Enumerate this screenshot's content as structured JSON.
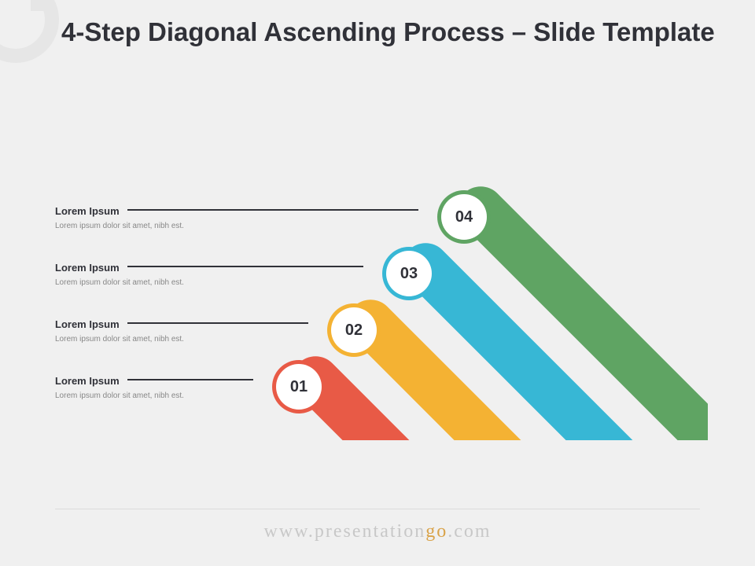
{
  "title": "4-Step Diagonal Ascending Process – Slide Template",
  "steps": [
    {
      "num": "01",
      "title": "Lorem Ipsum",
      "sub": "Lorem ipsum dolor sit amet, nibh est.",
      "color": "#e85a46"
    },
    {
      "num": "02",
      "title": "Lorem Ipsum",
      "sub": "Lorem ipsum dolor sit amet, nibh est.",
      "color": "#f4b233"
    },
    {
      "num": "03",
      "title": "Lorem Ipsum",
      "sub": "Lorem ipsum dolor sit amet, nibh est.",
      "color": "#37b7d5"
    },
    {
      "num": "04",
      "title": "Lorem Ipsum",
      "sub": "Lorem ipsum dolor sit amet, nibh est.",
      "color": "#5fa463"
    }
  ],
  "footer": {
    "pre": "www.",
    "mid_a": "presentation",
    "mid_b": "g",
    "mid_c": "o",
    "post": ".com"
  }
}
